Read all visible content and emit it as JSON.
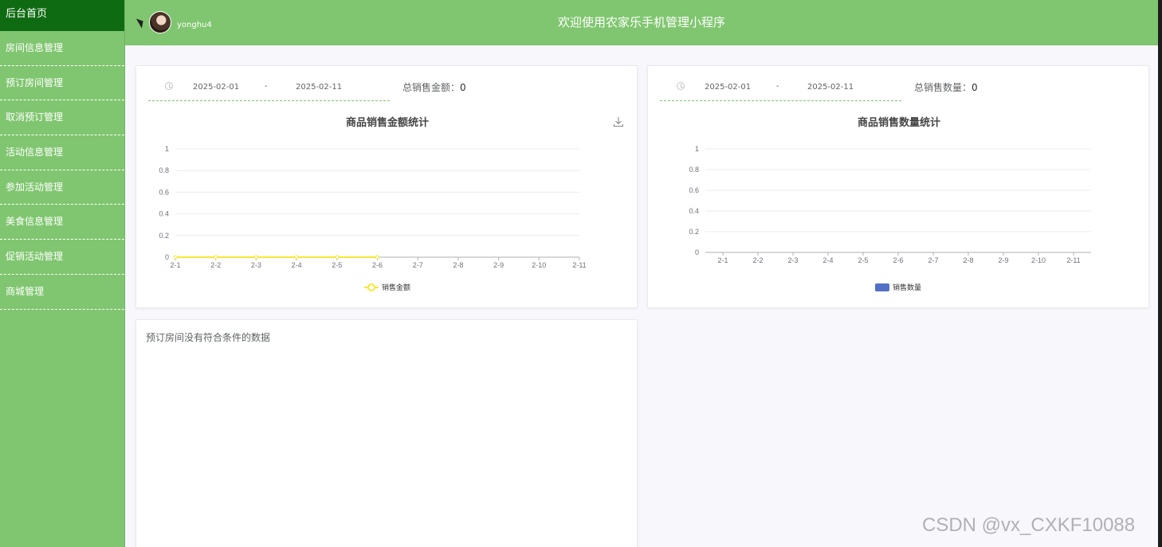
{
  "sidebar": {
    "items": [
      {
        "label": "后台首页"
      },
      {
        "label": "房间信息管理"
      },
      {
        "label": "预订房间管理"
      },
      {
        "label": "取消预订管理"
      },
      {
        "label": "活动信息管理"
      },
      {
        "label": "参加活动管理"
      },
      {
        "label": "美食信息管理"
      },
      {
        "label": "促销活动管理"
      },
      {
        "label": "商城管理"
      }
    ]
  },
  "header": {
    "username": "yonghu4",
    "title": "欢迎使用农家乐手机管理小程序"
  },
  "amount_card": {
    "start_date": "2025-02-01",
    "separator": "-",
    "end_date": "2025-02-11",
    "total_label": "总销售金额：",
    "total_value": "0"
  },
  "quantity_card": {
    "start_date": "2025-02-01",
    "separator": "-",
    "end_date": "2025-02-11",
    "total_label": "总销售数量：",
    "total_value": "0"
  },
  "chart_data": [
    {
      "type": "line",
      "title": "商品销售金额统计",
      "categories": [
        "2-1",
        "2-2",
        "2-3",
        "2-4",
        "2-5",
        "2-6",
        "2-7",
        "2-8",
        "2-9",
        "2-10",
        "2-11"
      ],
      "series": [
        {
          "name": "销售金额",
          "values": [
            0,
            0,
            0,
            0,
            0,
            0,
            null,
            null,
            null,
            null,
            null
          ],
          "color": "#f7e733"
        }
      ],
      "yticks": [
        "0",
        "0.2",
        "0.4",
        "0.6",
        "0.8",
        "1"
      ],
      "ylim": [
        0,
        1
      ],
      "legend": "bottom",
      "grid": true
    },
    {
      "type": "bar",
      "title": "商品销售数量统计",
      "categories": [
        "2-1",
        "2-2",
        "2-3",
        "2-4",
        "2-5",
        "2-6",
        "2-7",
        "2-8",
        "2-9",
        "2-10",
        "2-11"
      ],
      "series": [
        {
          "name": "销售数量",
          "values": [
            0,
            0,
            0,
            0,
            0,
            0,
            0,
            0,
            0,
            0,
            0
          ],
          "color": "#5470c6"
        }
      ],
      "yticks": [
        "0",
        "0.2",
        "0.4",
        "0.6",
        "0.8",
        "1"
      ],
      "ylim": [
        0,
        1
      ],
      "legend": "bottom",
      "grid": true
    }
  ],
  "booking_card": {
    "empty_text": "预订房间没有符合条件的数据"
  },
  "watermark": "CSDN @vx_CXKF10088"
}
